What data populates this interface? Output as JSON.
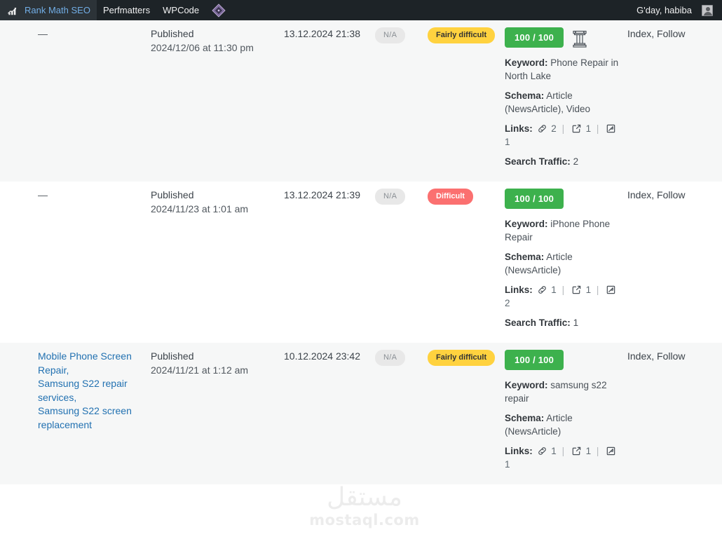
{
  "adminbar": {
    "left_items": [
      {
        "name": "rank-math-seo",
        "label": "Rank Math SEO",
        "icon": "rank-math-logo-icon"
      },
      {
        "name": "perfmatters",
        "label": "Perfmatters",
        "icon": null
      },
      {
        "name": "wpcode",
        "label": "WPCode",
        "icon": null
      },
      {
        "name": "diamond",
        "label": "",
        "icon": "diamond-icon"
      }
    ],
    "greeting": "G'day, habiba"
  },
  "watermark": {
    "arabic": "مستقل",
    "latin": "mostaql.com"
  },
  "labels": {
    "keyword": "Keyword:",
    "schema": "Schema:",
    "links": "Links:",
    "search_traffic": "Search Traffic:"
  },
  "colors": {
    "accent_green": "#3db14d",
    "pill_fairly": "#ffd23f",
    "pill_difficult": "#fb7070",
    "pill_na": "#e8e8e8",
    "link_blue": "#2271b1",
    "adminbar_bg": "#1d2327",
    "stripe_bg": "#f6f7f7"
  },
  "rows": [
    {
      "stripe": true,
      "keywords": [],
      "keywords_placeholder": "—",
      "status": "Published",
      "status_date": "2024/12/06 at 11:30 pm",
      "date": "13.12.2024 21:38",
      "na": "N/A",
      "difficulty": "Fairly difficult",
      "difficulty_style": "fairly",
      "seo_score": "100 / 100",
      "pillar": true,
      "keyword": "Phone Repair in North Lake",
      "schema": "Article (NewsArticle), Video",
      "links_internal": "2",
      "links_external": "1",
      "links_incoming": "1",
      "search_traffic": "2",
      "robots": "Index, Follow"
    },
    {
      "stripe": false,
      "keywords": [],
      "keywords_placeholder": "—",
      "status": "Published",
      "status_date": "2024/11/23 at 1:01 am",
      "date": "13.12.2024 21:39",
      "na": "N/A",
      "difficulty": "Difficult",
      "difficulty_style": "difficult",
      "seo_score": "100 / 100",
      "pillar": false,
      "keyword": "iPhone Phone Repair",
      "schema": "Article (NewsArticle)",
      "links_internal": "1",
      "links_external": "1",
      "links_incoming": "2",
      "search_traffic": "1",
      "robots": "Index, Follow"
    },
    {
      "stripe": true,
      "keywords": [
        "Mobile Phone Screen Repair,",
        "Samsung S22 repair services,",
        "Samsung S22 screen replacement"
      ],
      "keywords_placeholder": "",
      "status": "Published",
      "status_date": "2024/11/21 at 1:12 am",
      "date": "10.12.2024 23:42",
      "na": "N/A",
      "difficulty": "Fairly difficult",
      "difficulty_style": "fairly",
      "seo_score": "100 / 100",
      "pillar": false,
      "keyword": "samsung s22 repair",
      "schema": "Article (NewsArticle)",
      "links_internal": "1",
      "links_external": "1",
      "links_incoming": "1",
      "search_traffic": "",
      "robots": "Index, Follow"
    }
  ]
}
